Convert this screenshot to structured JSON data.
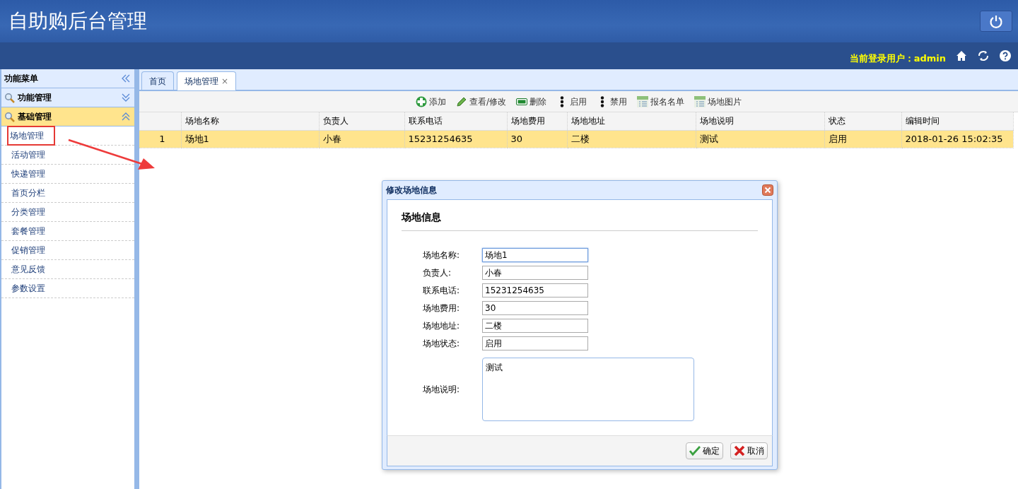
{
  "header": {
    "title": "自助购后台管理",
    "user_label": "当前登录用户：admin"
  },
  "sidebar": {
    "title": "功能菜单",
    "groups": [
      {
        "label": "功能管理",
        "expanded": false
      },
      {
        "label": "基础管理",
        "expanded": true,
        "items": [
          {
            "label": "场地管理",
            "highlighted": true
          },
          {
            "label": "活动管理",
            "highlighted": false
          },
          {
            "label": "快递管理",
            "highlighted": false
          },
          {
            "label": "首页分栏",
            "highlighted": false
          },
          {
            "label": "分类管理",
            "highlighted": false
          },
          {
            "label": "套餐管理",
            "highlighted": false
          },
          {
            "label": "促销管理",
            "highlighted": false
          },
          {
            "label": "意见反馈",
            "highlighted": false
          },
          {
            "label": "参数设置",
            "highlighted": false
          }
        ]
      }
    ]
  },
  "tabs": [
    {
      "label": "首页",
      "selected": false
    },
    {
      "label": "场地管理",
      "selected": true,
      "close": "×"
    }
  ],
  "toolbar": [
    {
      "kind": "add",
      "label": "添加"
    },
    {
      "kind": "edit",
      "label": "查看/修改"
    },
    {
      "kind": "delete",
      "label": "删除"
    },
    {
      "kind": "dots",
      "label": "启用"
    },
    {
      "kind": "dots",
      "label": "禁用"
    },
    {
      "kind": "list",
      "label": "报名名单"
    },
    {
      "kind": "list",
      "label": "场地图片"
    }
  ],
  "table": {
    "columns": [
      "场地名称",
      "负责人",
      "联系电话",
      "场地费用",
      "场地地址",
      "场地说明",
      "状态",
      "编辑时间"
    ],
    "rows": [
      {
        "row_number": "1",
        "selected": true,
        "cells": [
          "场地1",
          "小春",
          "15231254635",
          "30",
          "二楼",
          "测试",
          "启用",
          "2018-01-26 15:02:35"
        ]
      }
    ]
  },
  "dialog": {
    "title": "修改场地信息",
    "section_title": "场地信息",
    "fields": [
      {
        "kind": "input",
        "label": "场地名称:",
        "value": "场地1",
        "focused": true
      },
      {
        "kind": "input",
        "label": "负责人:",
        "value": "小春",
        "focused": false
      },
      {
        "kind": "input",
        "label": "联系电话:",
        "value": "15231254635",
        "focused": false
      },
      {
        "kind": "input",
        "label": "场地费用:",
        "value": "30",
        "focused": false
      },
      {
        "kind": "input",
        "label": "场地地址:",
        "value": "二楼",
        "focused": false
      },
      {
        "kind": "input",
        "label": "场地状态:",
        "value": "启用",
        "focused": false
      },
      {
        "kind": "textarea",
        "label": "场地说明:",
        "value": "测试",
        "focused": false
      }
    ],
    "buttons": [
      {
        "kind": "ok",
        "label": "确定"
      },
      {
        "kind": "cancel",
        "label": "取消"
      }
    ]
  }
}
